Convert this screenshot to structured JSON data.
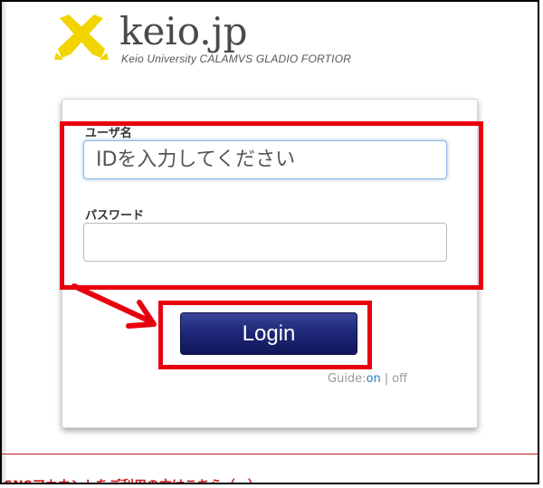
{
  "brand": {
    "title": "keio.jp",
    "subtitle": "Keio University CALAMVS GLADIO FORTIOR",
    "logo_icon": "crossed-pens-icon",
    "logo_color": "#f2d400"
  },
  "form": {
    "username_label": "ユーザ名",
    "username_placeholder": "IDを入力してください",
    "username_value": "",
    "password_label": "パスワード",
    "password_value": "",
    "login_label": "Login"
  },
  "guide": {
    "prefix": "Guide:",
    "on": "on",
    "separator": "|",
    "off": "off"
  },
  "footer": {
    "notice": "SNSアカウントをご利用の方はこちら（…）"
  },
  "annotations": {
    "highlight_color": "#e8000f",
    "arrow_icon": "red-arrow-icon"
  }
}
